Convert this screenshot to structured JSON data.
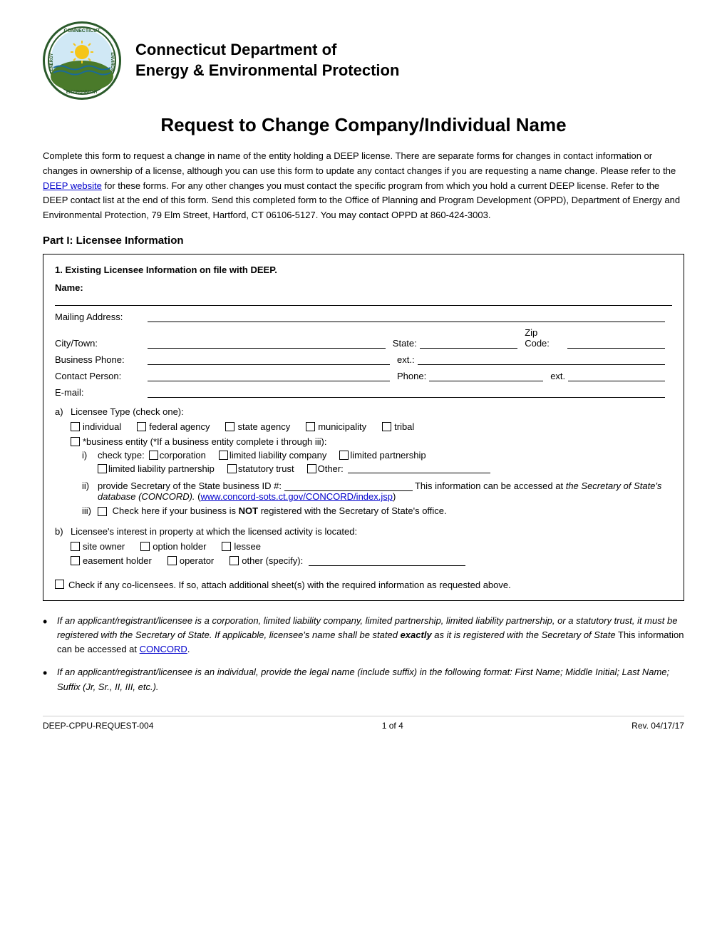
{
  "header": {
    "org_line1": "Connecticut Department of",
    "org_line2": "Energy & Environmental Protection"
  },
  "page_title": "Request to Change Company/Individual Name",
  "intro": {
    "text": "Complete this form to request a change in name of the entity holding a DEEP license.  There are separate forms for changes in contact information or changes in ownership of a license, although you can use this form to update any contact changes if you are requesting a name change. Please refer to the ",
    "link_text": "DEEP website",
    "link_url": "https://www.ct.gov/deep",
    "text2": " for these forms. For any other changes you must contact the specific program from which you hold a current DEEP license. Refer to the DEEP contact list at the end of this form. Send this completed form to the Office of Planning and Program Development (OPPD), Department of Energy and Environmental Protection, 79 Elm Street, Hartford, CT 06106-5127. You may contact OPPD at 860-424-3003."
  },
  "part1": {
    "title": "Part I:  Licensee Information",
    "section1": {
      "title": "1.   Existing Licensee Information on file with DEEP.",
      "name_label": "Name:",
      "mailing_label": "Mailing Address:",
      "city_label": "City/Town:",
      "state_label": "State:",
      "zip_label": "Zip Code:",
      "phone_label": "Business Phone:",
      "ext_label": "ext.:",
      "contact_label": "Contact Person:",
      "phone2_label": "Phone:",
      "ext2_label": "ext.",
      "email_label": "E-mail:"
    },
    "section_a": {
      "label": "a)",
      "title": "Licensee Type (check one):",
      "types": [
        "individual",
        "federal agency",
        "state agency",
        "municipality",
        "tribal"
      ],
      "business_entity": "*business entity (*If a business entity complete i through iii):",
      "check_type_label": "check type:",
      "check_types": [
        "corporation",
        "limited liability company",
        "limited partnership",
        "limited liability partnership",
        "statutory trust"
      ],
      "other_label": "Other:",
      "sub_ii": "provide Secretary of the State business ID #:",
      "sub_ii_text": "This information can be accessed at ",
      "sub_ii_italic": "the Secretary of State's database (CONCORD).",
      "sub_ii_link_text": "www.concord-sots.ct.gov/CONCORD/index.jsp",
      "sub_ii_link_url": "http://www.concord-sots.ct.gov/CONCORD/index.jsp",
      "sub_iii_text1": "Check here if your business is ",
      "sub_iii_bold": "NOT",
      "sub_iii_text2": " registered with the Secretary of State's office."
    },
    "section_b": {
      "label": "b)",
      "title": "Licensee's interest in property at which the licensed activity is located:",
      "interests": [
        "site owner",
        "option holder",
        "lessee",
        "easement holder",
        "operator",
        "other (specify):"
      ]
    },
    "co_licensee": "Check if any co-licensees. If so, attach additional sheet(s) with the required information as requested above."
  },
  "bullets": [
    {
      "text1": "If an applicant/registrant/licensee is a corporation, limited liability company, limited partnership, limited liability partnership, or a statutory trust, it must be registered with the Secretary of State. If applicable, licensee's name shall be stated ",
      "bold": "exactly",
      "text2": " as it is registered with the Secretary of State",
      "text3": " This information can be accessed at ",
      "link_text": "CONCORD",
      "link_url": "http://www.concord-sots.ct.gov/CONCORD/index.jsp",
      "text4": "."
    },
    {
      "text1": "If an applicant/registrant/licensee is an individual, provide the legal name (include suffix) in the following format: First Name; Middle Initial; Last Name; Suffix (Jr, Sr., II, III, etc.)."
    }
  ],
  "footer": {
    "left": "DEEP-CPPU-REQUEST-004",
    "center": "1 of 4",
    "right": "Rev. 04/17/17"
  }
}
